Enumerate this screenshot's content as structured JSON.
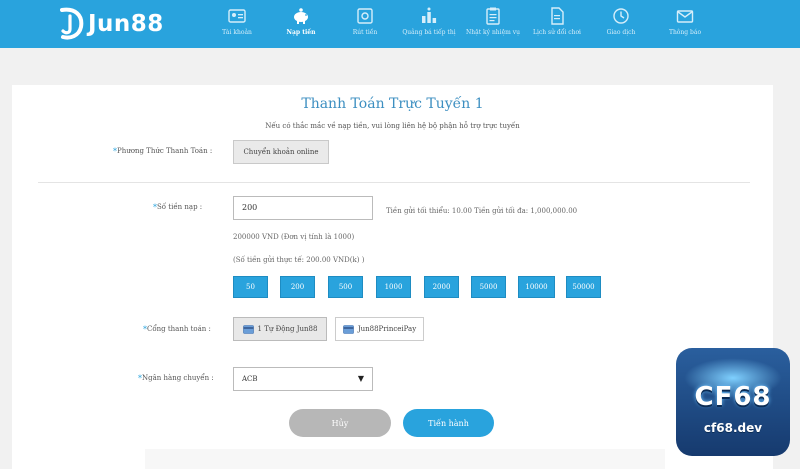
{
  "header": {
    "logo_text": "Jun88",
    "nav": [
      {
        "label": "Tài khoản",
        "icon": "id-card-icon",
        "active": false
      },
      {
        "label": "Nạp tiền",
        "icon": "piggy-bank-icon",
        "active": true
      },
      {
        "label": "Rút tiền",
        "icon": "safe-icon",
        "active": false
      },
      {
        "label": "Quảng bá tiếp thị",
        "icon": "ranking-icon",
        "active": false
      },
      {
        "label": "Nhật ký nhiệm vụ",
        "icon": "clipboard-icon",
        "active": false
      },
      {
        "label": "Lịch sử đổi chơi",
        "icon": "document-icon",
        "active": false
      },
      {
        "label": "Giao dịch",
        "icon": "clock-icon",
        "active": false
      },
      {
        "label": "Thông báo",
        "icon": "envelope-icon",
        "active": false
      }
    ]
  },
  "form": {
    "title": "Thanh Toán Trực Tuyến 1",
    "notice": "Nếu có thắc mắc về nạp tiền, vui lòng liên hệ bộ phận hỗ trợ trực tuyến",
    "method_label": "Phương Thức Thanh Toán :",
    "method_value": "Chuyển khoản online",
    "amount_label": "Số tiền nạp :",
    "amount_value": "200",
    "amount_limits": "Tiền gửi tối thiểu: 10.00 Tiền gửi tối đa: 1,000,000.00",
    "amount_vnd": "200000 VND (Đơn vị tính là 1000)",
    "amount_actual": "(Số tiền gửi thực tế: 200.00 VND(k) )",
    "quick_amounts": [
      "50",
      "200",
      "500",
      "1000",
      "2000",
      "5000",
      "10000",
      "50000"
    ],
    "gateway_label": "Cổng thanh toán :",
    "gateways": [
      "1 Tự Động Jun88",
      "Jun88PrinceiPay"
    ],
    "bank_label": "Ngân hàng chuyển :",
    "bank_value": "ACB",
    "cancel_label": "Hủy",
    "submit_label": "Tiến hành"
  },
  "watermark": {
    "title": "CF68",
    "subtitle": "cf68.dev"
  },
  "colors": {
    "primary": "#29a3dd",
    "title": "#3d8fc1",
    "cancel": "#b7b7b7"
  }
}
